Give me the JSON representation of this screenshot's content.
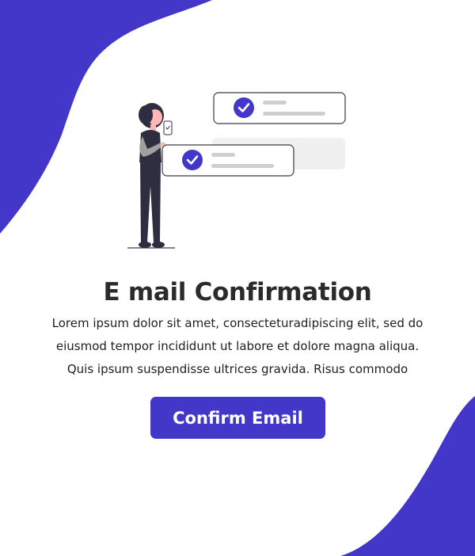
{
  "colors": {
    "accent": "#4337c9",
    "title": "#2b2b2b",
    "text": "#1f1f1f",
    "background": "#ffffff"
  },
  "title": "E mail Confirmation",
  "body": {
    "line1": "Lorem ipsum dolor sit amet, consecteturadipiscing elit, sed do",
    "line2": "eiusmod tempor incididunt ut labore et dolore magna aliqua.",
    "line3": "Quis ipsum suspendisse ultrices gravida. Risus commodo"
  },
  "confirm_button": {
    "label": "Confirm Email"
  },
  "illustration": {
    "icons": [
      "checkmark-icon",
      "checkmark-icon"
    ]
  }
}
